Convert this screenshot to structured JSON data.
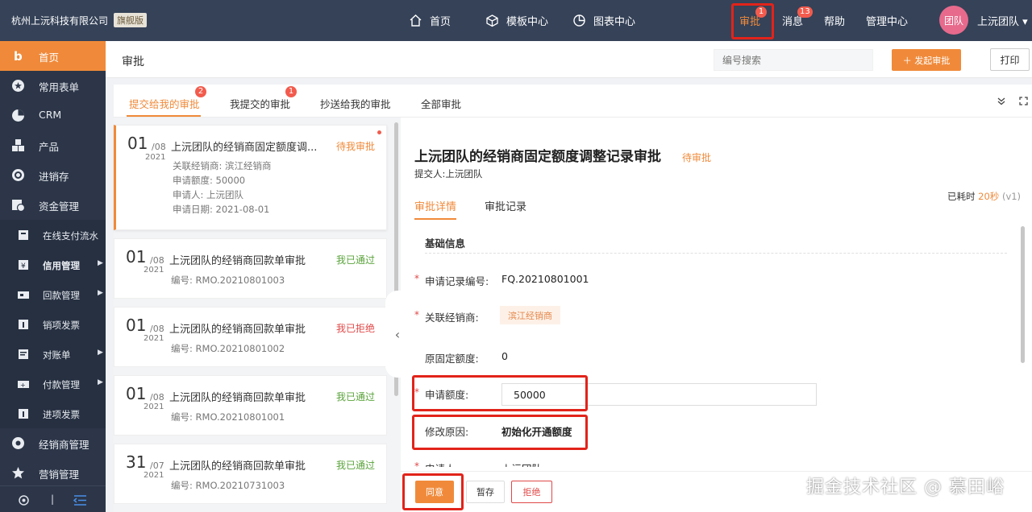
{
  "topbar": {
    "company": "杭州上沅科技有限公司",
    "edition": "旗舰版",
    "nav": [
      {
        "label": "首页",
        "icon": "home-icon"
      },
      {
        "label": "模板中心",
        "icon": "cube-icon"
      },
      {
        "label": "图表中心",
        "icon": "pie-chart-icon"
      }
    ],
    "approval": "审批",
    "approval_badge": "1",
    "messages": "消息",
    "messages_badge": "13",
    "help": "帮助",
    "admin": "管理中心",
    "avatar_text": "团队",
    "team_name": "上沅团队",
    "team_caret": "▾"
  },
  "sidebar": {
    "items": [
      {
        "label": "首页",
        "icon": "logo-b-icon",
        "active": true
      },
      {
        "label": "常用表单",
        "icon": "star-icon"
      },
      {
        "label": "CRM",
        "icon": "pie-icon"
      },
      {
        "label": "产品",
        "icon": "boxes-icon"
      },
      {
        "label": "进销存",
        "icon": "cycle-icon"
      },
      {
        "label": "资金管理",
        "icon": "money-icon"
      }
    ],
    "subitems": [
      {
        "label": "在线支付流水",
        "icon": "pay-icon",
        "arrow": ""
      },
      {
        "label": "信用管理",
        "icon": "credit-icon",
        "arrow": "▶"
      },
      {
        "label": "回款管理",
        "icon": "receive-icon",
        "arrow": "▶"
      },
      {
        "label": "销项发票",
        "icon": "invoice-icon",
        "arrow": ""
      },
      {
        "label": "对账单",
        "icon": "statement-icon",
        "arrow": "▶"
      },
      {
        "label": "付款管理",
        "icon": "payment-icon",
        "arrow": "▶"
      },
      {
        "label": "进项发票",
        "icon": "invoice-in-icon",
        "arrow": ""
      }
    ],
    "items2": [
      {
        "label": "经销商管理",
        "icon": "dealer-icon"
      },
      {
        "label": "营销管理",
        "icon": "marketing-icon"
      }
    ],
    "bottom_sep": "|"
  },
  "header": {
    "title": "审批",
    "search_placeholder": "编号搜索",
    "start_label": "＋ 发起审批",
    "print_label": "打印"
  },
  "tabs": [
    {
      "label": "提交给我的审批",
      "badge": "2",
      "active": true
    },
    {
      "label": "我提交的审批",
      "badge": "1"
    },
    {
      "label": "抄送给我的审批",
      "badge": ""
    },
    {
      "label": "全部审批",
      "badge": ""
    }
  ],
  "list": {
    "cards": [
      {
        "day": "01",
        "month": "/08",
        "year": "2021",
        "title": "上沅团队的经销商固定额度调...",
        "status": "待我审批",
        "status_type": "pending",
        "lines": [
          "关联经销商: 滨江经销商",
          "申请额度: 50000",
          "申请人: 上沅团队",
          "申请日期: 2021-08-01"
        ]
      },
      {
        "day": "01",
        "month": "/08",
        "year": "2021",
        "title": "上沅团队的经销商回款单审批",
        "status": "我已通过",
        "status_type": "passed",
        "lines": [
          "编号: RMO.20210801003"
        ]
      },
      {
        "day": "01",
        "month": "/08",
        "year": "2021",
        "title": "上沅团队的经销商回款单审批",
        "status": "我已拒绝",
        "status_type": "rejected",
        "lines": [
          "编号: RMO.20210801002"
        ]
      },
      {
        "day": "01",
        "month": "/08",
        "year": "2021",
        "title": "上沅团队的经销商回款单审批",
        "status": "我已通过",
        "status_type": "passed",
        "lines": [
          "编号: RMO.20210801001"
        ]
      },
      {
        "day": "31",
        "month": "/07",
        "year": "2021",
        "title": "上沅团队的经销商回款单审批",
        "status": "我已通过",
        "status_type": "passed",
        "lines": [
          "编号: RMO.20210731003"
        ]
      }
    ],
    "collapse_glyph": "‹"
  },
  "detail": {
    "title": "上沅团队的经销商固定额度调整记录审批",
    "status": "待审批",
    "submitter": "提交人:上沅团队",
    "tabs": [
      "审批详情",
      "审批记录"
    ],
    "elapsed_label": "已耗时",
    "elapsed_value": "20秒",
    "version": "(v1)",
    "section": "基础信息",
    "fields": {
      "record_no_label": "申请记录编号:",
      "record_no": "FQ.20210801001",
      "dealer_label": "关联经销商:",
      "dealer": "滨江经销商",
      "orig_label": "原固定额度:",
      "orig": "0",
      "amount_label": "申请额度:",
      "amount": "50000",
      "reason_label": "修改原因:",
      "reason": "初始化开通额度",
      "applicant_label": "申请人:",
      "applicant": "上沅团队"
    },
    "buttons": {
      "agree": "同意",
      "save": "暂存",
      "reject": "拒绝"
    }
  },
  "watermark": "掘金技术社区 @ 慕田峪",
  "colors": {
    "accent": "#f08a3a",
    "topbar": "#354258",
    "sidebar": "#2c3648",
    "highlight": "#e2231a"
  }
}
